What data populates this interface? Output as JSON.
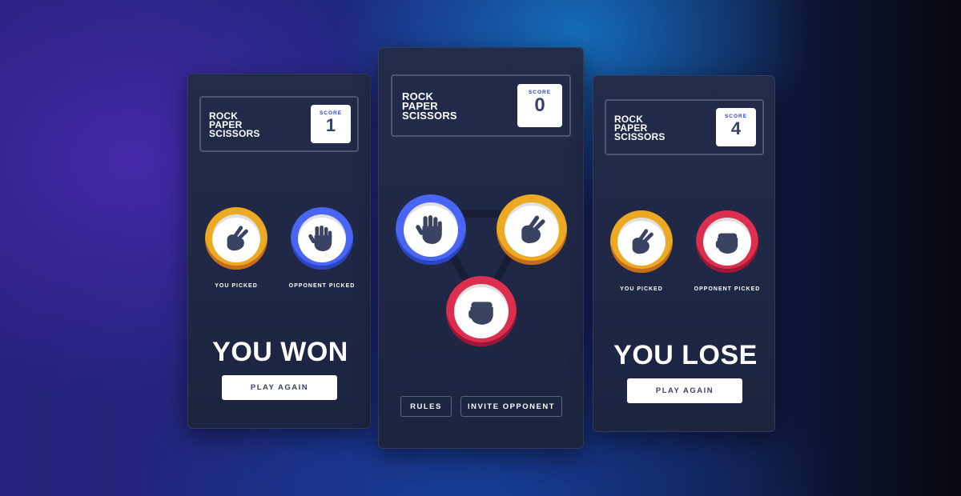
{
  "game": {
    "title": "ROCK\nPAPER\nSCISSORS",
    "score_label": "SCORE"
  },
  "cards": [
    {
      "score": "1",
      "you_label": "YOU PICKED",
      "opponent_label": "OPPONENT PICKED",
      "you_pick": "scissors",
      "opponent_pick": "paper",
      "result": "YOU WON",
      "play_again": "PLAY AGAIN"
    },
    {
      "score": "0",
      "choices": [
        "paper",
        "scissors",
        "rock"
      ],
      "rules": "RULES",
      "invite": "INVITE OPPONENT"
    },
    {
      "score": "4",
      "you_label": "YOU PICKED",
      "opponent_label": "OPPONENT PICKED",
      "you_pick": "scissors",
      "opponent_pick": "rock",
      "result": "YOU LOSE",
      "play_again": "PLAY AGAIN"
    }
  ],
  "colors": {
    "paper": "#4865f4",
    "scissors": "#eca922",
    "rock": "#dc2e4e",
    "card": "#1f2745",
    "text_dark": "#3b4363"
  }
}
